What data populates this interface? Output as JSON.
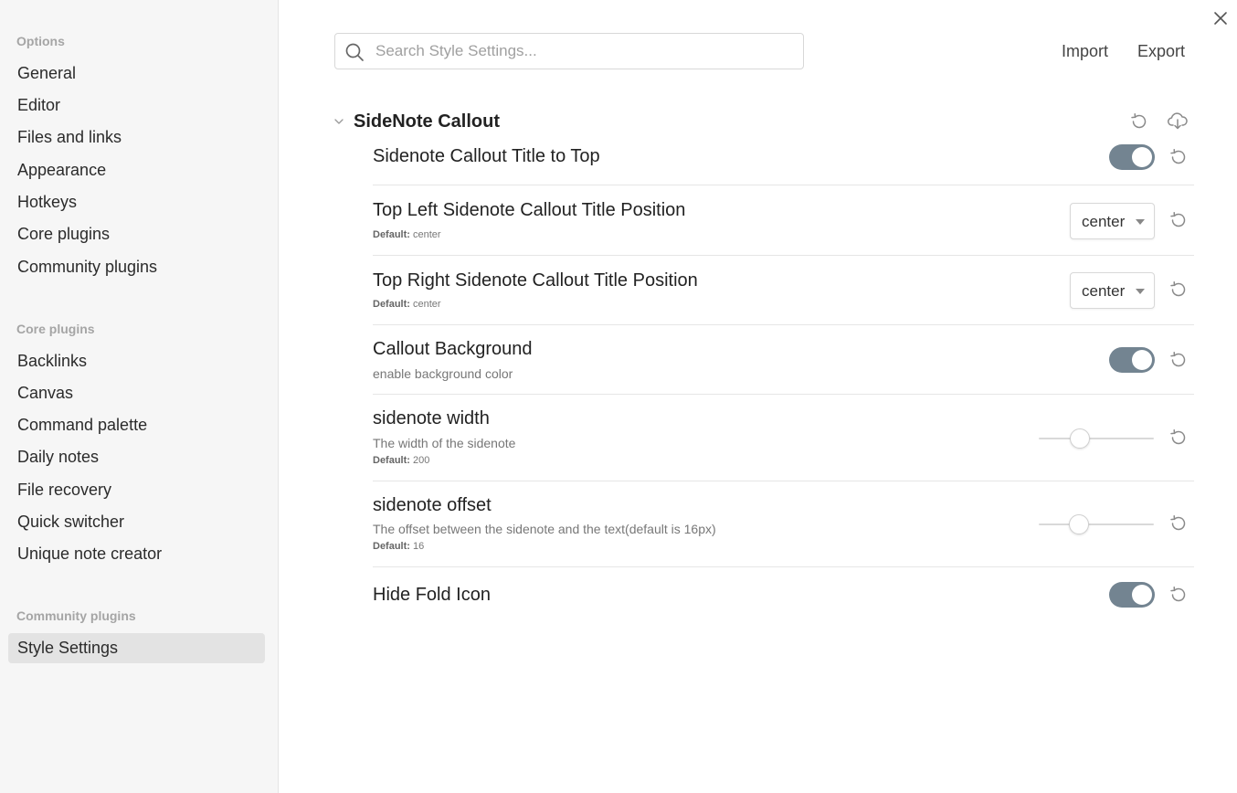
{
  "sidebar": {
    "options_heading": "Options",
    "options_items": [
      "General",
      "Editor",
      "Files and links",
      "Appearance",
      "Hotkeys",
      "Core plugins",
      "Community plugins"
    ],
    "core_heading": "Core plugins",
    "core_items": [
      "Backlinks",
      "Canvas",
      "Command palette",
      "Daily notes",
      "File recovery",
      "Quick switcher",
      "Unique note creator"
    ],
    "community_heading": "Community plugins",
    "community_items": [
      "Style Settings"
    ],
    "active_item": "Style Settings"
  },
  "search": {
    "placeholder": "Search Style Settings...",
    "value": ""
  },
  "toolbar": {
    "import_label": "Import",
    "export_label": "Export"
  },
  "section": {
    "title": "SideNote Callout",
    "expanded": true
  },
  "settings": [
    {
      "name": "Sidenote Callout Title to Top",
      "type": "toggle",
      "value": true
    },
    {
      "name": "Top Left Sidenote Callout Title Position",
      "type": "dropdown",
      "value": "center",
      "default_label": "Default:",
      "default_value": "center"
    },
    {
      "name": "Top Right Sidenote Callout Title Position",
      "type": "dropdown",
      "value": "center",
      "default_label": "Default:",
      "default_value": "center"
    },
    {
      "name": "Callout Background",
      "type": "toggle",
      "value": true,
      "description": "enable background color"
    },
    {
      "name": "sidenote width",
      "type": "slider",
      "slider_fraction": 0.36,
      "description": "The width of the sidenote",
      "default_label": "Default:",
      "default_value": "200"
    },
    {
      "name": "sidenote offset",
      "type": "slider",
      "slider_fraction": 0.35,
      "description": "The offset between the sidenote and the text(default is 16px)",
      "default_label": "Default:",
      "default_value": "16"
    },
    {
      "name": "Hide Fold Icon",
      "type": "toggle",
      "value": true
    }
  ],
  "colors": {
    "toggle_on": "#738491",
    "sidebar_bg": "#f6f6f6",
    "active_item_bg": "#e3e3e3"
  },
  "icons": {
    "close": "close-icon",
    "search": "search-icon",
    "reset": "reset-icon",
    "export_section": "download-cloud-icon",
    "collapse": "chevron-down-icon"
  }
}
